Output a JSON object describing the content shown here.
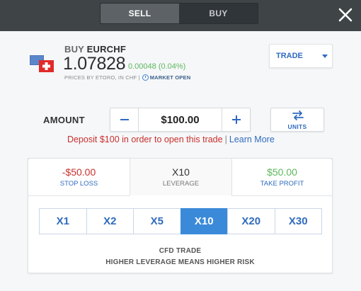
{
  "topbar": {
    "sell_label": "SELL",
    "buy_label": "BUY"
  },
  "instrument": {
    "direction": "BUY",
    "symbol": "EURCHF",
    "price": "1.07828",
    "change": "0.00048 (0.04%)",
    "prices_by": "PRICES BY ETORO, IN CHF |",
    "market_status": "MARKET OPEN"
  },
  "order_type": {
    "selected": "TRADE"
  },
  "amount": {
    "label": "AMOUNT",
    "value": "$100.00",
    "units_label": "UNITS"
  },
  "deposit_notice": {
    "text": "Deposit $100 in order to open this trade",
    "separator": "|",
    "link": "Learn More"
  },
  "tabs": {
    "stop_loss": {
      "value": "-$50.00",
      "label": "STOP LOSS"
    },
    "leverage": {
      "value": "X10",
      "label": "LEVERAGE"
    },
    "take_profit": {
      "value": "$50.00",
      "label": "TAKE PROFIT"
    }
  },
  "leverage_options": [
    "X1",
    "X2",
    "X5",
    "X10",
    "X20",
    "X30"
  ],
  "leverage_selected": "X10",
  "footer": {
    "line1": "CFD TRADE",
    "line2": "HIGHER LEVERAGE MEANS HIGHER RISK"
  },
  "colors": {
    "topbar": "#3f4547",
    "accent": "#2f6bbf",
    "active_leverage": "#3b8ad9",
    "negative": "#c9302c",
    "positive": "#5cb85c"
  }
}
